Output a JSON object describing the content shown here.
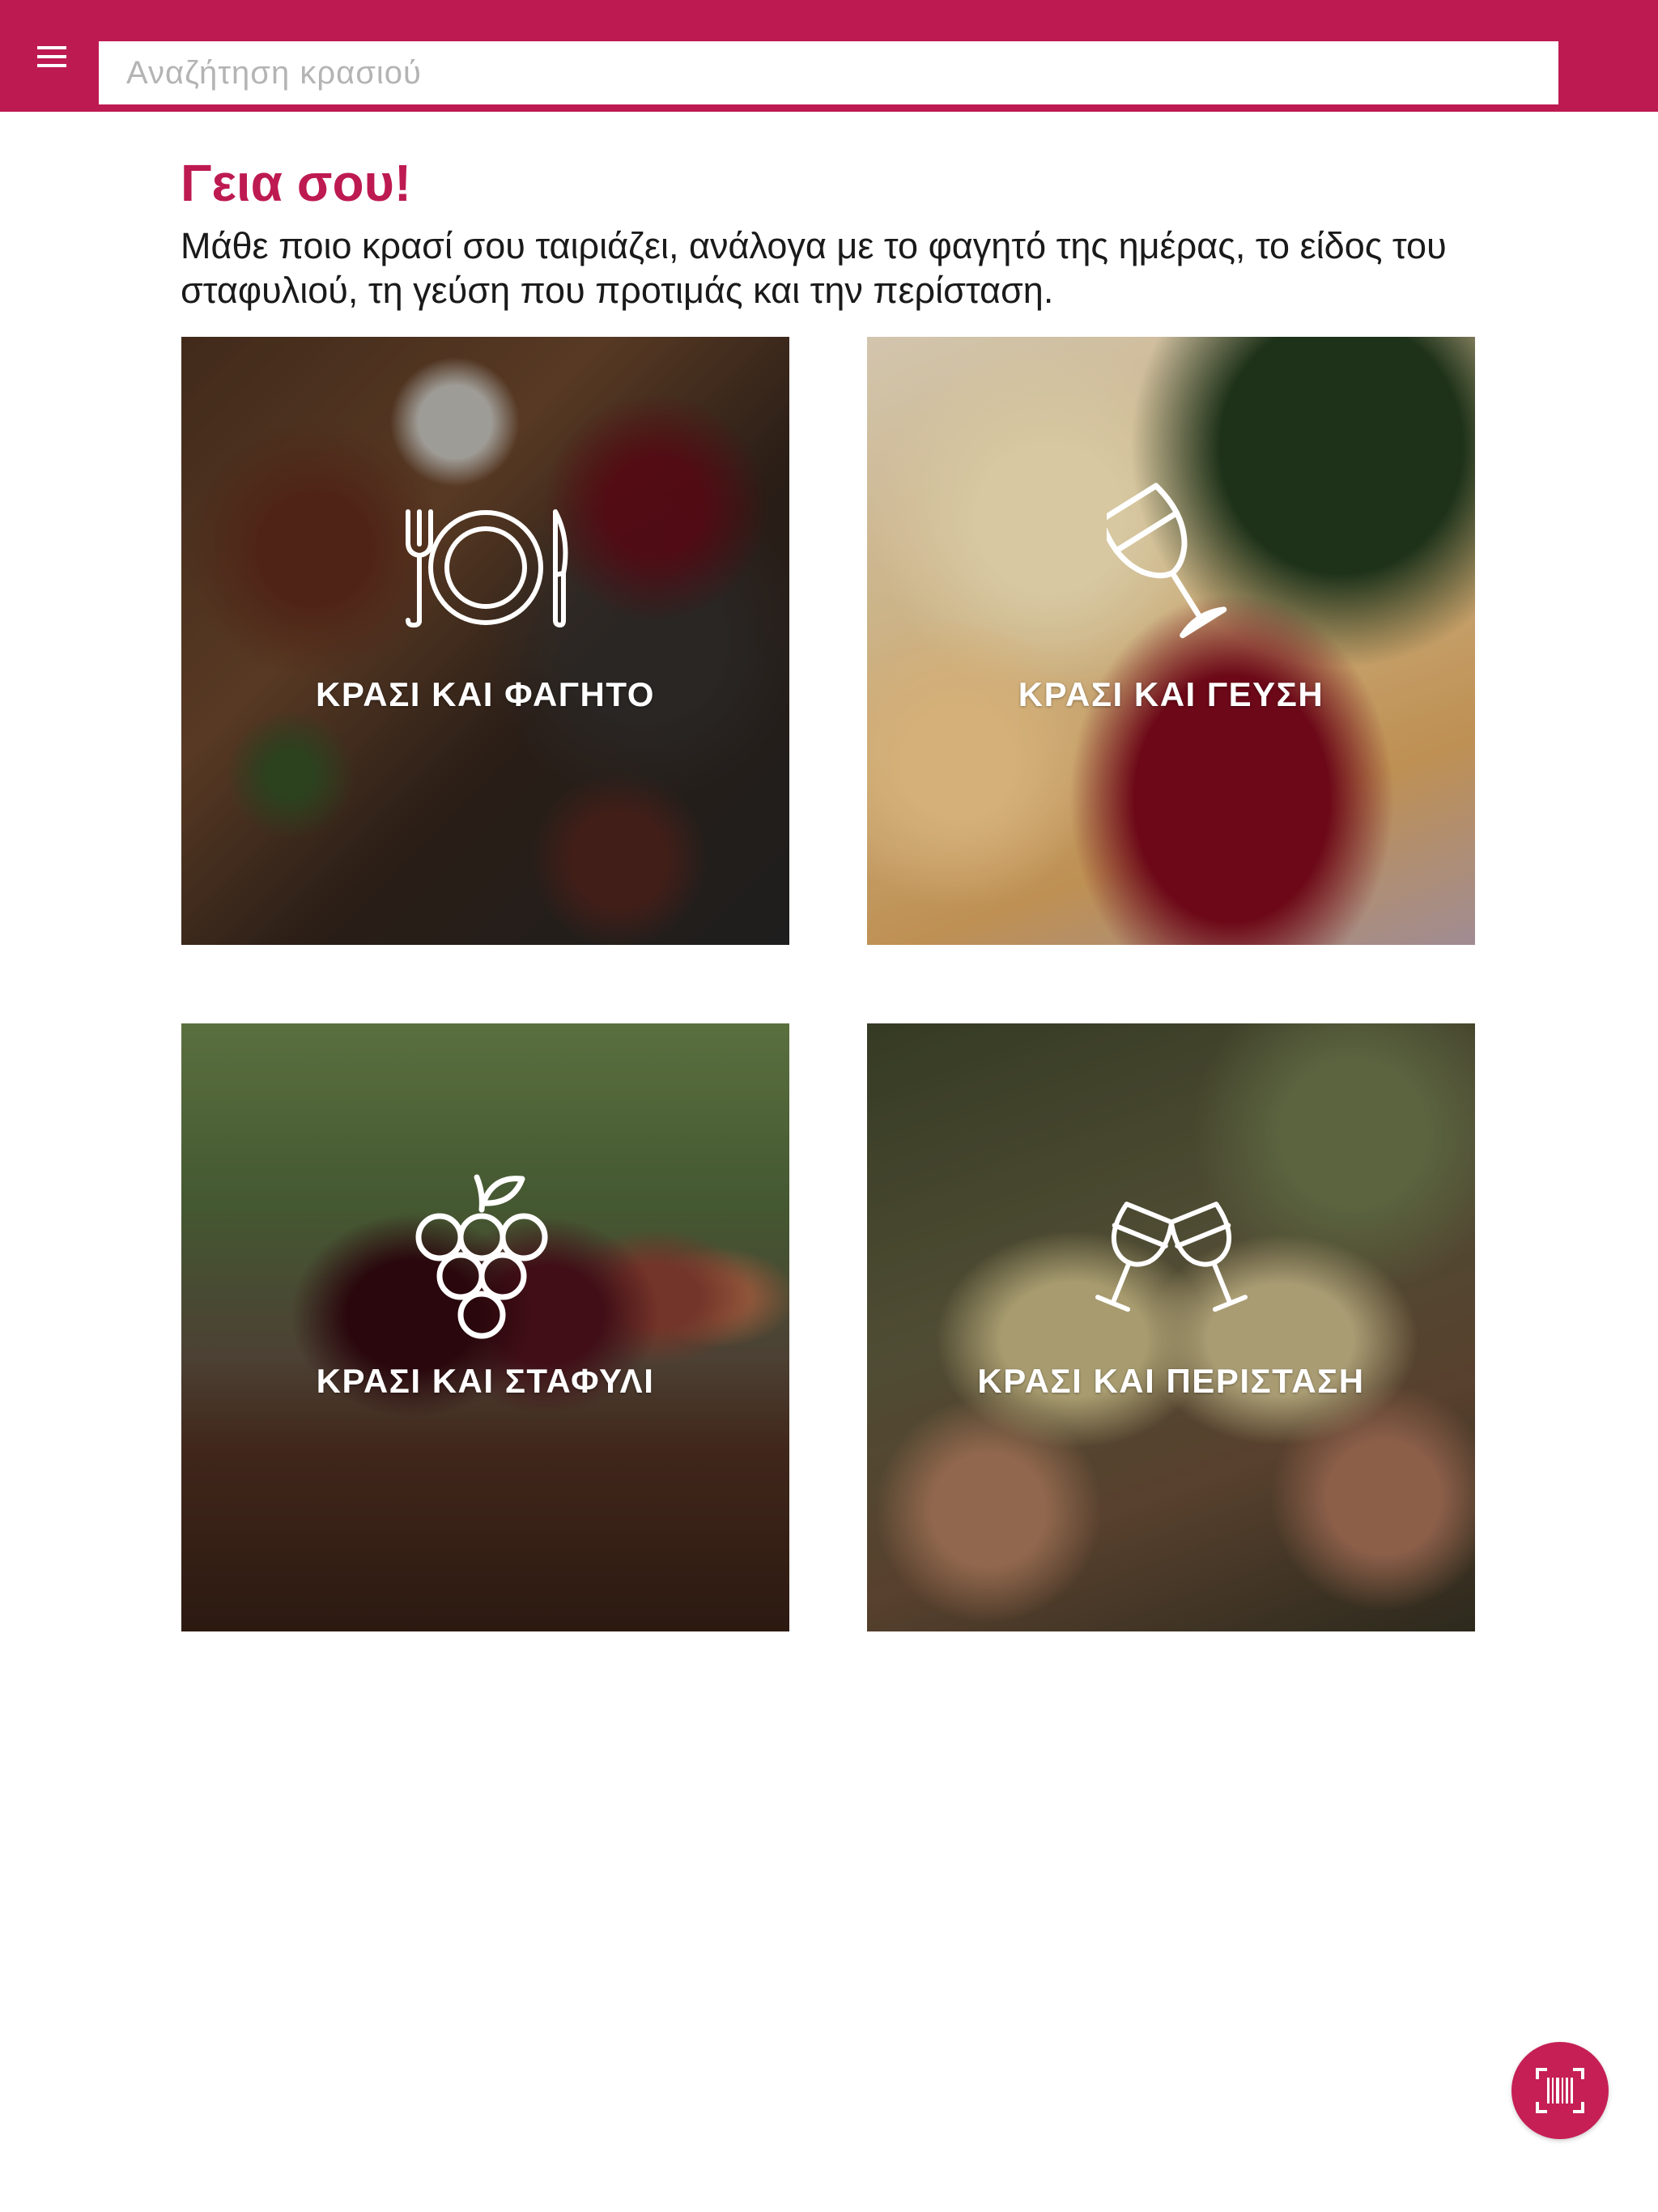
{
  "header": {
    "search_placeholder": "Αναζήτηση κρασιού",
    "menu_icon": "hamburger-menu-icon"
  },
  "main": {
    "greeting": "Γεια σου!",
    "intro": "Μάθε ποιο κρασί σου ταιριάζει, ανάλογα με το φαγητό της ημέρας, το είδος του σταφυλιού, τη γεύση που προτιμάς και την περίσταση.",
    "cards": [
      {
        "label": "ΚΡΑΣΙ ΚΑΙ ΦΑΓΗΤΟ",
        "icon": "fork-plate-knife-icon"
      },
      {
        "label": "ΚΡΑΣΙ ΚΑΙ ΓΕΥΣΗ",
        "icon": "wine-glass-icon"
      },
      {
        "label": "ΚΡΑΣΙ ΚΑΙ ΣΤΑΦΥΛΙ",
        "icon": "grapes-icon"
      },
      {
        "label": "ΚΡΑΣΙ ΚΑΙ ΠΕΡΙΣΤΑΣΗ",
        "icon": "toast-glasses-icon"
      }
    ]
  },
  "fab": {
    "icon": "barcode-scan-icon"
  },
  "colors": {
    "brand": "#be1a52",
    "text": "#1a1a1a",
    "placeholder": "#b4b4b4"
  }
}
